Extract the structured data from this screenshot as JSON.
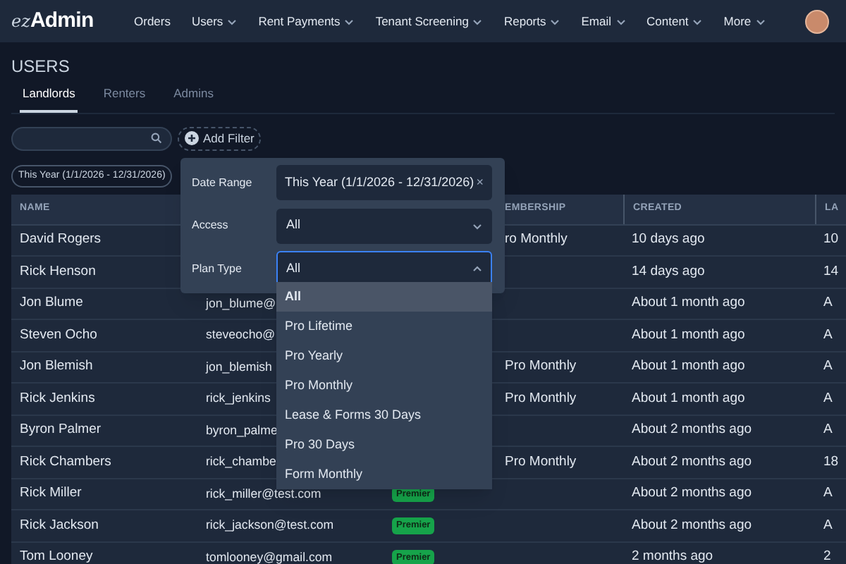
{
  "nav": {
    "logo_prefix": "ez",
    "logo": "Admin",
    "items": [
      {
        "label": "Orders",
        "dropdown": false
      },
      {
        "label": "Users",
        "dropdown": true
      },
      {
        "label": "Rent Payments",
        "dropdown": true
      },
      {
        "label": "Tenant Screening",
        "dropdown": true
      },
      {
        "label": "Reports",
        "dropdown": true
      },
      {
        "label": "Email",
        "dropdown": true
      },
      {
        "label": "Content",
        "dropdown": true
      },
      {
        "label": "More",
        "dropdown": true
      }
    ]
  },
  "page_title": "USERS",
  "tabs": [
    {
      "label": "Landlords",
      "selected": true
    },
    {
      "label": "Renters",
      "selected": false
    },
    {
      "label": "Admins",
      "selected": false
    }
  ],
  "add_filter": "Add Filter",
  "active_filter": "This Year (1/1/2026 - 12/31/2026)",
  "table": {
    "headers": {
      "name": "NAME",
      "membership": "EMBERSHIP",
      "created": "CREATED",
      "column_6": "LA"
    },
    "rows": [
      {
        "name": "David Rogers",
        "membership": "ro Monthly",
        "created": "10 days ago",
        "column_6": "10"
      },
      {
        "name": "Rick Henson",
        "created": "14 days ago",
        "column_6": "14"
      },
      {
        "name": "Jon Blume",
        "column_2": "jon_blume@",
        "created": "About 1 month ago",
        "column_6": "A"
      },
      {
        "name": "Steven Ocho",
        "column_2": "steveocho@",
        "created": "About 1 month ago",
        "column_6": "A"
      },
      {
        "name": "Jon Blemish",
        "column_2": "jon_blemish",
        "membership": "Pro Monthly",
        "created": "About 1 month ago",
        "column_6": "A"
      },
      {
        "name": "Rick Jenkins",
        "column_2": "rick_jenkins",
        "membership": "Pro Monthly",
        "created": "About 1 month ago",
        "column_6": "A"
      },
      {
        "name": "Byron Palmer",
        "column_2": "byron_palme",
        "created": "About 2 months ago",
        "column_6": "A"
      },
      {
        "name": "Rick Chambers",
        "column_2": "rick_chambe",
        "membership": "Pro Monthly",
        "created": "About 2 months ago",
        "column_6": "18"
      },
      {
        "name": "Rick Miller",
        "column_2": "rick_miller@test.com",
        "column_3": "Premier",
        "created": "About 2 months ago",
        "column_6": "A"
      },
      {
        "name": "Rick Jackson",
        "column_2": "rick_jackson@test.com",
        "column_3": "Premier",
        "created": "About 2 months ago",
        "column_6": "A"
      },
      {
        "name": "Tom Looney",
        "column_2": "tomlooney@gmail.com",
        "column_3": "Premier",
        "created": "2 months ago",
        "column_6": "2"
      }
    ]
  },
  "filter_popup": {
    "fields": [
      {
        "kind": "clearable",
        "label": "Date Range",
        "value": "This Year (1/1/2026 - 12/31/2026)",
        "clear": "×"
      },
      {
        "kind": "select",
        "label": "Access",
        "value": "All",
        "open": false
      },
      {
        "kind": "select",
        "label": "Plan Type",
        "value": "All",
        "open": true
      }
    ],
    "options": [
      {
        "label": "All",
        "selected": true
      },
      {
        "label": "Pro Lifetime",
        "selected": false
      },
      {
        "label": "Pro Yearly",
        "selected": false
      },
      {
        "label": "Pro Monthly",
        "selected": false
      },
      {
        "label": "Lease & Forms 30 Days",
        "selected": false
      },
      {
        "label": "Pro 30 Days",
        "selected": false
      },
      {
        "label": "Form Monthly",
        "selected": false
      }
    ]
  }
}
